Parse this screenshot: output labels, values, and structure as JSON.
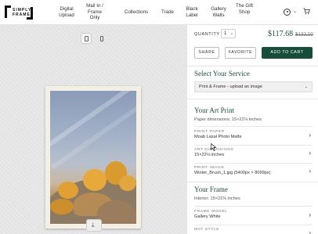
{
  "header": {
    "logo": {
      "line1": "SIMPLY",
      "line2": "FRAMED"
    },
    "nav": [
      {
        "label": "Digital Upload"
      },
      {
        "label": "Mail In / Frame Only"
      },
      {
        "label": "Collections"
      },
      {
        "label": "Trade"
      },
      {
        "label": "Black Label"
      },
      {
        "label": "Gallery Walls"
      },
      {
        "label": "The Gift Shop"
      }
    ],
    "icons": {
      "user": "user-icon",
      "dropdown": "chevron-down-icon",
      "cart": "cart-icon"
    },
    "dropdown_glyph": "⌄",
    "cart_glyph": "🛒"
  },
  "viewer": {
    "device_toggle": [
      "desktop-icon",
      "mobile-icon"
    ],
    "download_glyph": "⤓"
  },
  "purchase": {
    "quantity_label": "QUANTITY",
    "quantity_value": "1",
    "caret": "⌄",
    "price": "$117.68",
    "old_price": "$133.50",
    "share_label": "SHARE",
    "favorite_label": "FAVORITE",
    "add_to_cart_label": "ADD TO CART",
    "accent_color": "#164d3b"
  },
  "service": {
    "title": "Select Your Service",
    "selected": "Print & Frame - upload an image"
  },
  "art_print": {
    "title": "Your Art Print",
    "dimensions": "Paper dimensions: 15×22⅛ inches",
    "options": [
      {
        "label": "PRINT PAPER",
        "value": "Moab Lasal Photo Matte"
      },
      {
        "label": "ART DIMENSIONS",
        "value": "15×22⅛ inches"
      },
      {
        "label": "PRINT IMAGE",
        "value": "Winter_Brush_1.jpg (5400px × 8099px)"
      }
    ]
  },
  "frame": {
    "title": "Your Frame",
    "interior": "Interior: 15×22⅛ inches",
    "options": [
      {
        "label": "FRAME MODEL",
        "value": "Gallery White"
      },
      {
        "label": "MAT STYLE",
        "value": ""
      }
    ]
  },
  "arrow_glyph": "›"
}
